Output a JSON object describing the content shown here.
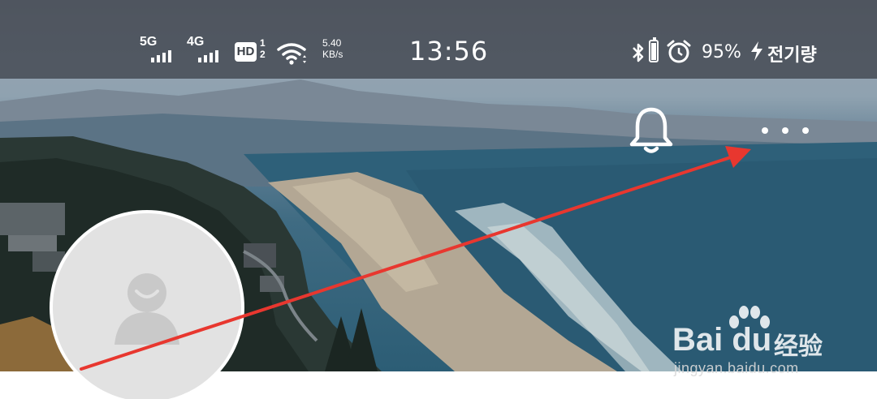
{
  "status_bar": {
    "network_1": "5G",
    "network_2": "4G",
    "hd_label": "HD",
    "hd_sub_top": "1",
    "hd_sub_bottom": "2",
    "speed_value": "5.40",
    "speed_unit": "KB/s",
    "time": "13:56",
    "battery_percent": "95%",
    "battery_level": 0.95,
    "charging_label": "전기량",
    "icons": [
      "signal-icon",
      "wifi-icon",
      "bluetooth-icon",
      "battery-icon",
      "alarm-icon",
      "charging-bolt-icon"
    ]
  },
  "header": {
    "icons": [
      "notification-bell-icon",
      "more-options-icon"
    ]
  },
  "profile": {
    "avatar_icon": "default-user-icon"
  },
  "annotation": {
    "type": "red-arrow",
    "color": "#e8372f"
  },
  "watermark": {
    "logo_text": "Bai du",
    "logo_cn": "经验",
    "url": "jingyan.baidu.com"
  },
  "colors": {
    "arrow": "#e8372f",
    "status_bar_bg": "#373c44",
    "avatar_bg": "#e2e2e2"
  }
}
